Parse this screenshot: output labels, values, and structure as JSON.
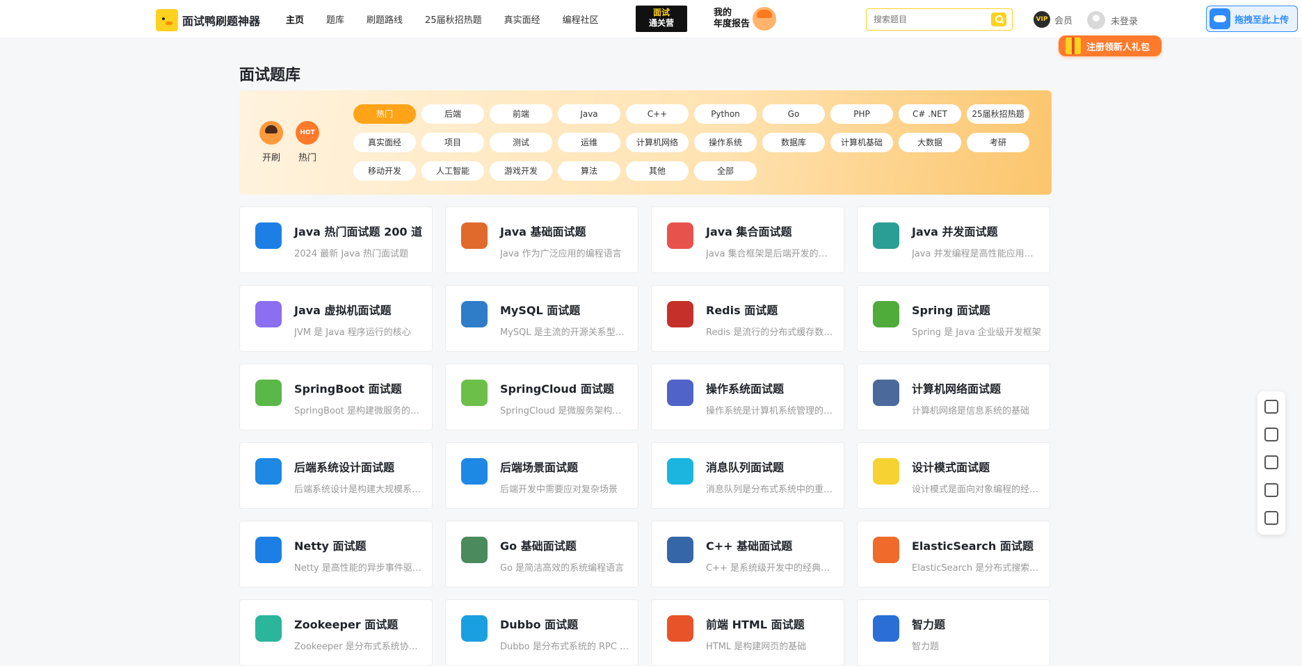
{
  "header": {
    "logo_text": "面试鸭刷题神器",
    "nav": [
      "主页",
      "题库",
      "刷题路线",
      "25届秋招热题",
      "真实面经",
      "编程社区"
    ],
    "promo1": {
      "top": "面试",
      "bottom": "通关营"
    },
    "promo2": {
      "line1": "我的",
      "line2": "年度报告"
    },
    "search_placeholder": "搜索题目",
    "vip_badge": "VIP",
    "vip_label": "会员",
    "login_label": "未登录",
    "upload_label": "拖拽至此上传",
    "gift_label": "注册领新人礼包"
  },
  "page": {
    "title": "面试题库",
    "quick": [
      {
        "label": "开刷"
      },
      {
        "label": "热门",
        "badge": "HOT"
      }
    ],
    "tags": [
      [
        "热门",
        "后端",
        "前端",
        "Java",
        "C++",
        "Python",
        "Go",
        "PHP",
        "C# .NET",
        "25届秋招热题"
      ],
      [
        "真实面经",
        "项目",
        "测试",
        "运维",
        "计算机网络",
        "操作系统",
        "数据库",
        "计算机基础",
        "大数据",
        "考研"
      ],
      [
        "移动开发",
        "人工智能",
        "游戏开发",
        "算法",
        "其他",
        "全部"
      ]
    ],
    "active_tag": "热门"
  },
  "cards": [
    {
      "title": "Java 热门面试题 200 道",
      "desc": "2024 最新 Java 热门面试题",
      "icon": "code-monitor-icon",
      "color": "#1d7fe6"
    },
    {
      "title": "Java 基础面试题",
      "desc": "Java 作为广泛应用的编程语言",
      "icon": "java-cup-icon",
      "color": "#e06a2c"
    },
    {
      "title": "Java 集合面试题",
      "desc": "Java 集合框架是后端开发的核心",
      "icon": "stack-layers-icon",
      "color": "#e8524d"
    },
    {
      "title": "Java 并发面试题",
      "desc": "Java 并发编程是高性能应用的基础",
      "icon": "concurrency-icon",
      "color": "#2a9d95"
    },
    {
      "title": "Java 虚拟机面试题",
      "desc": "JVM 是 Java 程序运行的核心",
      "icon": "jvm-icon",
      "color": "#8b6ff0"
    },
    {
      "title": "MySQL 面试题",
      "desc": "MySQL 是主流的开源关系型数据库",
      "icon": "mysql-dolphin-icon",
      "color": "#2f7cc8"
    },
    {
      "title": "Redis 面试题",
      "desc": "Redis 是流行的分布式缓存数据库",
      "icon": "redis-icon",
      "color": "#c6302b"
    },
    {
      "title": "Spring 面试题",
      "desc": "Spring 是 Java 企业级开发框架",
      "icon": "spring-leaf-icon",
      "color": "#4fab3a"
    },
    {
      "title": "SpringBoot 面试题",
      "desc": "SpringBoot 是构建微服务的框架",
      "icon": "springboot-icon",
      "color": "#5ab848"
    },
    {
      "title": "SpringCloud 面试题",
      "desc": "SpringCloud 是微服务架构框架",
      "icon": "springcloud-icon",
      "color": "#6cc04a"
    },
    {
      "title": "操作系统面试题",
      "desc": "操作系统是计算机系统管理的核心",
      "icon": "gear-icon",
      "color": "#5063c9"
    },
    {
      "title": "计算机网络面试题",
      "desc": "计算机网络是信息系统的基础",
      "icon": "network-globe-icon",
      "color": "#4b6a9b"
    },
    {
      "title": "后端系统设计面试题",
      "desc": "后端系统设计是构建大规模系统的关键",
      "icon": "design-tools-icon",
      "color": "#1e88e5"
    },
    {
      "title": "后端场景面试题",
      "desc": "后端开发中需要应对复杂场景",
      "icon": "clover-grid-icon",
      "color": "#1e88e5"
    },
    {
      "title": "消息队列面试题",
      "desc": "消息队列是分布式系统中的重要组件",
      "icon": "message-queue-icon",
      "color": "#1cb5e0"
    },
    {
      "title": "设计模式面试题",
      "desc": "设计模式是面向对象编程的经验总结",
      "icon": "note-icon",
      "color": "#f6d232"
    },
    {
      "title": "Netty 面试题",
      "desc": "Netty 是高性能的异步事件驱动框架",
      "icon": "netty-icon",
      "color": "#1d7fe6"
    },
    {
      "title": "Go 基础面试题",
      "desc": "Go 是简洁高效的系统编程语言",
      "icon": "go-window-icon",
      "color": "#4a8a5c"
    },
    {
      "title": "C++ 基础面试题",
      "desc": "C++ 是系统级开发中的经典语言",
      "icon": "cpp-hexagon-icon",
      "color": "#3566a8"
    },
    {
      "title": "ElasticSearch 面试题",
      "desc": "ElasticSearch 是分布式搜索引擎",
      "icon": "elasticsearch-icon",
      "color": "#f06a2b"
    },
    {
      "title": "Zookeeper 面试题",
      "desc": "Zookeeper 是分布式系统协调服务",
      "icon": "zookeeper-icon",
      "color": "#2bb59b"
    },
    {
      "title": "Dubbo 面试题",
      "desc": "Dubbo 是分布式系统的 RPC 框架",
      "icon": "dubbo-icon",
      "color": "#1aa0e0"
    },
    {
      "title": "前端 HTML 面试题",
      "desc": "HTML 是构建网页的基础",
      "icon": "html5-shield-icon",
      "color": "#e8532a"
    },
    {
      "title": "智力题",
      "desc": "智力题",
      "icon": "brain-bulb-icon",
      "color": "#2b6fd6"
    }
  ],
  "side_tools": [
    "customer-service-icon",
    "wechat-icon",
    "mobile-icon",
    "edit-icon",
    "headset-icon"
  ]
}
